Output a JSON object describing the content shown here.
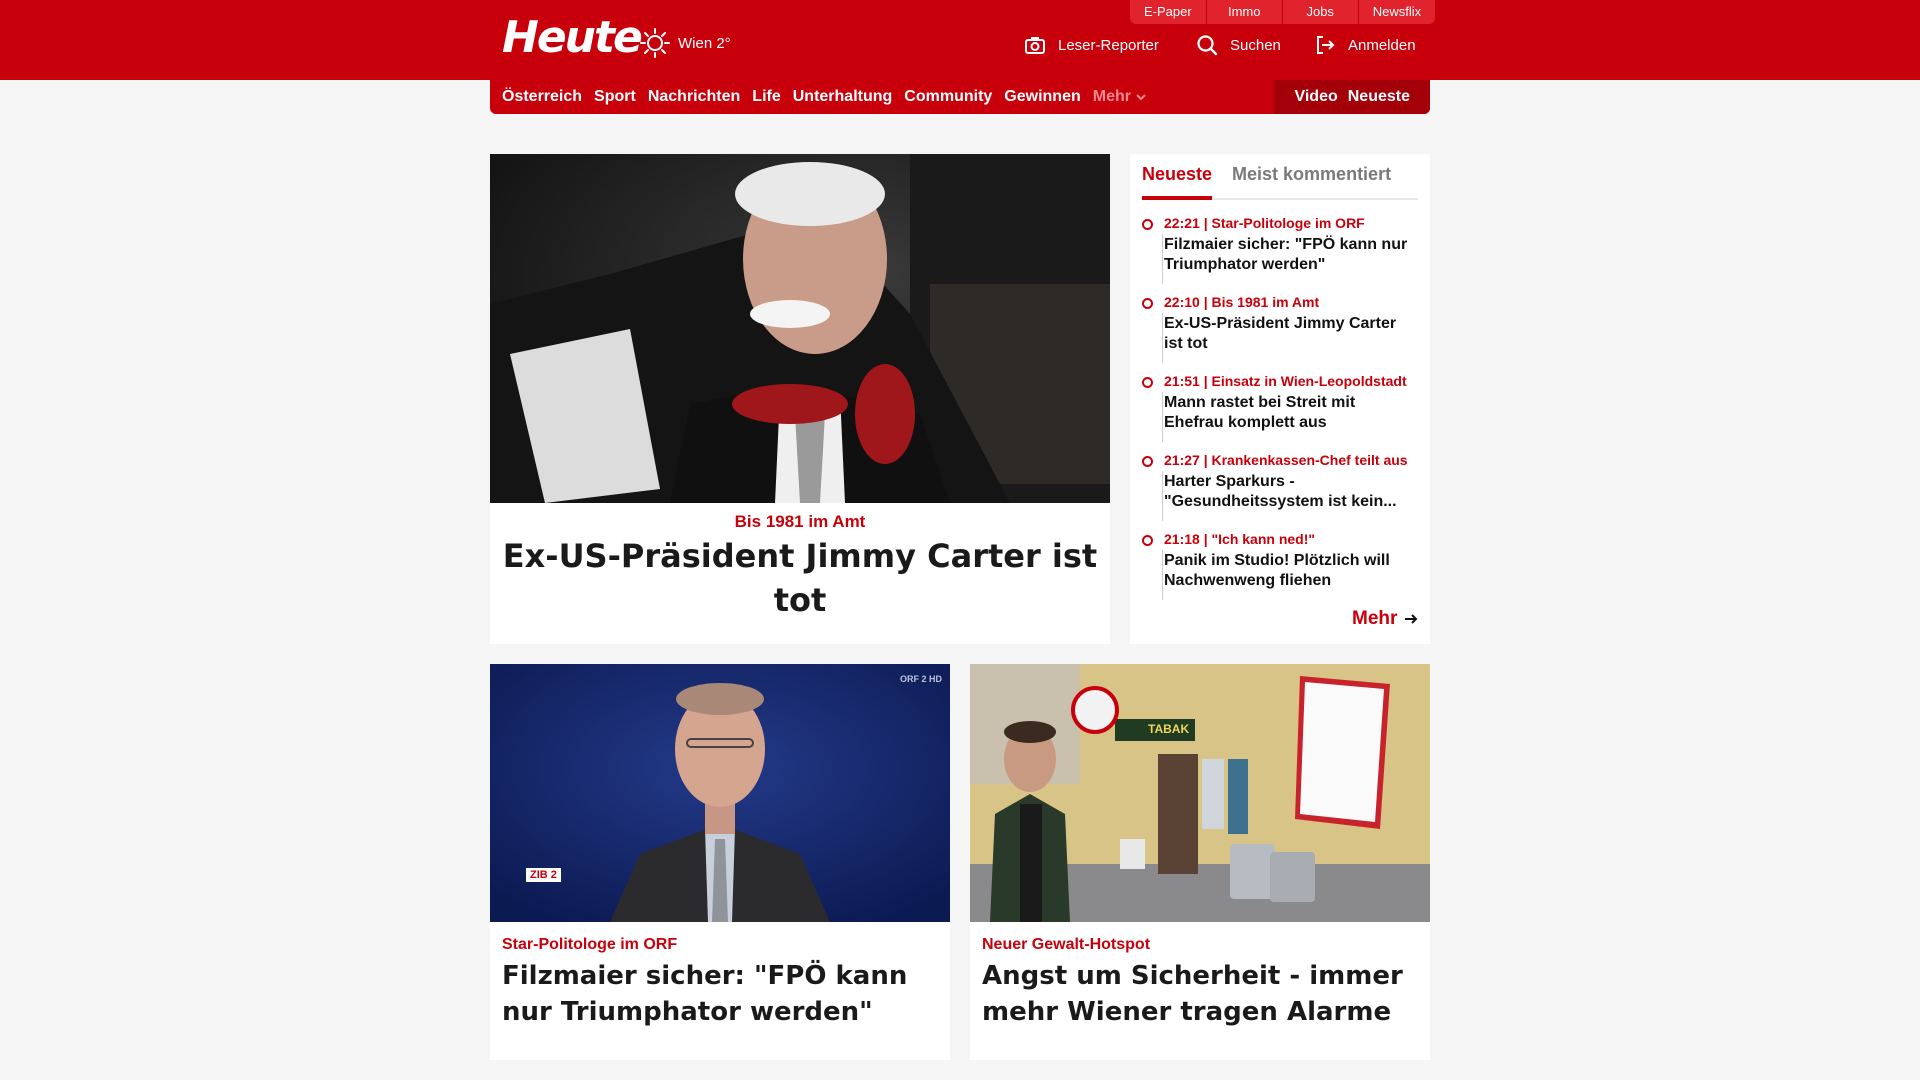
{
  "header": {
    "logo": "Heute",
    "weather_city": "Wien 2°",
    "top_links": [
      "E-Paper",
      "Immo",
      "Jobs",
      "Newsflix"
    ],
    "leser_reporter": "Leser-Reporter",
    "search": "Suchen",
    "login": "Anmelden"
  },
  "nav": {
    "items": [
      "Österreich",
      "Sport",
      "Nachrichten",
      "Life",
      "Unterhaltung",
      "Community",
      "Gewinnen"
    ],
    "more": "Mehr",
    "video": "Video",
    "neueste": "Neueste"
  },
  "hero": {
    "kicker": "Bis 1981 im Amt",
    "headline": "Ex-US-Präsident Jimmy Carter ist tot"
  },
  "sidebar": {
    "tabs": [
      "Neueste",
      "Meist kommentiert"
    ],
    "items": [
      {
        "time": "22:21 | Star-Politologe im ORF",
        "title": "Filzmaier sicher: \"FPÖ kann nur Triumphator werden\""
      },
      {
        "time": "22:10 | Bis 1981 im Amt",
        "title": "Ex-US-Präsident Jimmy Carter ist tot"
      },
      {
        "time": "21:51 | Einsatz in Wien-Leopoldstadt",
        "title": "Mann rastet bei Streit mit Ehefrau komplett aus"
      },
      {
        "time": "21:27 | Krankenkassen-Chef teilt aus",
        "title": "Harter Sparkurs - \"Gesundheitssystem ist kein..."
      },
      {
        "time": "21:18 | \"Ich kann ned!\"",
        "title": "Panik im Studio! Plötzlich will Nachwenweng fliehen"
      }
    ],
    "more": "Mehr"
  },
  "cards": [
    {
      "kicker": "Star-Politologe im ORF",
      "headline": "Filzmaier sicher: \"FPÖ kann nur Triumphator werden\"",
      "badge": "ZIB 2",
      "channel": "ORF 2 HD"
    },
    {
      "kicker": "Neuer Gewalt-Hotspot",
      "headline": "Angst um Sicherheit - immer mehr Wiener tragen Alarme",
      "shop_sign": "TABAK"
    }
  ],
  "colors": {
    "brand": "#c8000b",
    "background": "#f5f5f5"
  }
}
